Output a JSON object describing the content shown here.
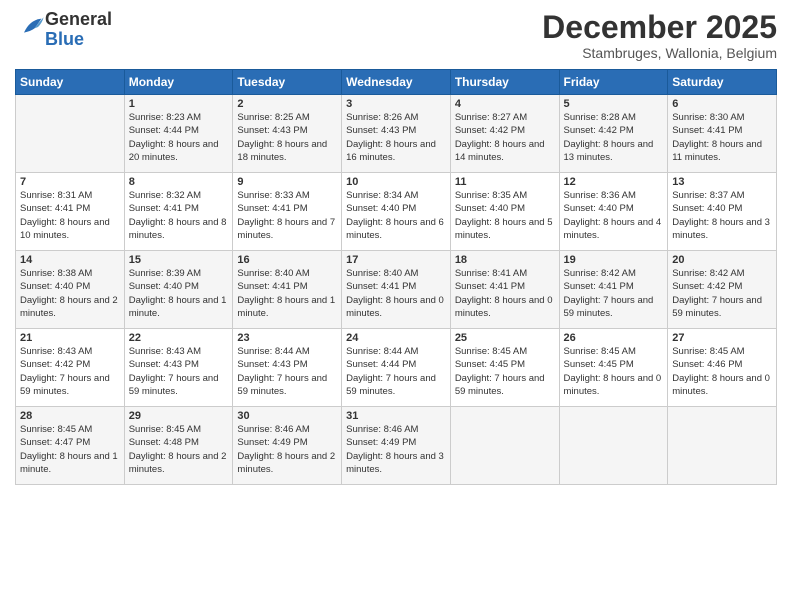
{
  "header": {
    "logo_general": "General",
    "logo_blue": "Blue",
    "month": "December 2025",
    "location": "Stambruges, Wallonia, Belgium"
  },
  "days_of_week": [
    "Sunday",
    "Monday",
    "Tuesday",
    "Wednesday",
    "Thursday",
    "Friday",
    "Saturday"
  ],
  "weeks": [
    [
      {
        "day": "",
        "sunrise": "",
        "sunset": "",
        "daylight": ""
      },
      {
        "day": "1",
        "sunrise": "Sunrise: 8:23 AM",
        "sunset": "Sunset: 4:44 PM",
        "daylight": "Daylight: 8 hours and 20 minutes."
      },
      {
        "day": "2",
        "sunrise": "Sunrise: 8:25 AM",
        "sunset": "Sunset: 4:43 PM",
        "daylight": "Daylight: 8 hours and 18 minutes."
      },
      {
        "day": "3",
        "sunrise": "Sunrise: 8:26 AM",
        "sunset": "Sunset: 4:43 PM",
        "daylight": "Daylight: 8 hours and 16 minutes."
      },
      {
        "day": "4",
        "sunrise": "Sunrise: 8:27 AM",
        "sunset": "Sunset: 4:42 PM",
        "daylight": "Daylight: 8 hours and 14 minutes."
      },
      {
        "day": "5",
        "sunrise": "Sunrise: 8:28 AM",
        "sunset": "Sunset: 4:42 PM",
        "daylight": "Daylight: 8 hours and 13 minutes."
      },
      {
        "day": "6",
        "sunrise": "Sunrise: 8:30 AM",
        "sunset": "Sunset: 4:41 PM",
        "daylight": "Daylight: 8 hours and 11 minutes."
      }
    ],
    [
      {
        "day": "7",
        "sunrise": "Sunrise: 8:31 AM",
        "sunset": "Sunset: 4:41 PM",
        "daylight": "Daylight: 8 hours and 10 minutes."
      },
      {
        "day": "8",
        "sunrise": "Sunrise: 8:32 AM",
        "sunset": "Sunset: 4:41 PM",
        "daylight": "Daylight: 8 hours and 8 minutes."
      },
      {
        "day": "9",
        "sunrise": "Sunrise: 8:33 AM",
        "sunset": "Sunset: 4:41 PM",
        "daylight": "Daylight: 8 hours and 7 minutes."
      },
      {
        "day": "10",
        "sunrise": "Sunrise: 8:34 AM",
        "sunset": "Sunset: 4:40 PM",
        "daylight": "Daylight: 8 hours and 6 minutes."
      },
      {
        "day": "11",
        "sunrise": "Sunrise: 8:35 AM",
        "sunset": "Sunset: 4:40 PM",
        "daylight": "Daylight: 8 hours and 5 minutes."
      },
      {
        "day": "12",
        "sunrise": "Sunrise: 8:36 AM",
        "sunset": "Sunset: 4:40 PM",
        "daylight": "Daylight: 8 hours and 4 minutes."
      },
      {
        "day": "13",
        "sunrise": "Sunrise: 8:37 AM",
        "sunset": "Sunset: 4:40 PM",
        "daylight": "Daylight: 8 hours and 3 minutes."
      }
    ],
    [
      {
        "day": "14",
        "sunrise": "Sunrise: 8:38 AM",
        "sunset": "Sunset: 4:40 PM",
        "daylight": "Daylight: 8 hours and 2 minutes."
      },
      {
        "day": "15",
        "sunrise": "Sunrise: 8:39 AM",
        "sunset": "Sunset: 4:40 PM",
        "daylight": "Daylight: 8 hours and 1 minute."
      },
      {
        "day": "16",
        "sunrise": "Sunrise: 8:40 AM",
        "sunset": "Sunset: 4:41 PM",
        "daylight": "Daylight: 8 hours and 1 minute."
      },
      {
        "day": "17",
        "sunrise": "Sunrise: 8:40 AM",
        "sunset": "Sunset: 4:41 PM",
        "daylight": "Daylight: 8 hours and 0 minutes."
      },
      {
        "day": "18",
        "sunrise": "Sunrise: 8:41 AM",
        "sunset": "Sunset: 4:41 PM",
        "daylight": "Daylight: 8 hours and 0 minutes."
      },
      {
        "day": "19",
        "sunrise": "Sunrise: 8:42 AM",
        "sunset": "Sunset: 4:41 PM",
        "daylight": "Daylight: 7 hours and 59 minutes."
      },
      {
        "day": "20",
        "sunrise": "Sunrise: 8:42 AM",
        "sunset": "Sunset: 4:42 PM",
        "daylight": "Daylight: 7 hours and 59 minutes."
      }
    ],
    [
      {
        "day": "21",
        "sunrise": "Sunrise: 8:43 AM",
        "sunset": "Sunset: 4:42 PM",
        "daylight": "Daylight: 7 hours and 59 minutes."
      },
      {
        "day": "22",
        "sunrise": "Sunrise: 8:43 AM",
        "sunset": "Sunset: 4:43 PM",
        "daylight": "Daylight: 7 hours and 59 minutes."
      },
      {
        "day": "23",
        "sunrise": "Sunrise: 8:44 AM",
        "sunset": "Sunset: 4:43 PM",
        "daylight": "Daylight: 7 hours and 59 minutes."
      },
      {
        "day": "24",
        "sunrise": "Sunrise: 8:44 AM",
        "sunset": "Sunset: 4:44 PM",
        "daylight": "Daylight: 7 hours and 59 minutes."
      },
      {
        "day": "25",
        "sunrise": "Sunrise: 8:45 AM",
        "sunset": "Sunset: 4:45 PM",
        "daylight": "Daylight: 7 hours and 59 minutes."
      },
      {
        "day": "26",
        "sunrise": "Sunrise: 8:45 AM",
        "sunset": "Sunset: 4:45 PM",
        "daylight": "Daylight: 8 hours and 0 minutes."
      },
      {
        "day": "27",
        "sunrise": "Sunrise: 8:45 AM",
        "sunset": "Sunset: 4:46 PM",
        "daylight": "Daylight: 8 hours and 0 minutes."
      }
    ],
    [
      {
        "day": "28",
        "sunrise": "Sunrise: 8:45 AM",
        "sunset": "Sunset: 4:47 PM",
        "daylight": "Daylight: 8 hours and 1 minute."
      },
      {
        "day": "29",
        "sunrise": "Sunrise: 8:45 AM",
        "sunset": "Sunset: 4:48 PM",
        "daylight": "Daylight: 8 hours and 2 minutes."
      },
      {
        "day": "30",
        "sunrise": "Sunrise: 8:46 AM",
        "sunset": "Sunset: 4:49 PM",
        "daylight": "Daylight: 8 hours and 2 minutes."
      },
      {
        "day": "31",
        "sunrise": "Sunrise: 8:46 AM",
        "sunset": "Sunset: 4:49 PM",
        "daylight": "Daylight: 8 hours and 3 minutes."
      },
      {
        "day": "",
        "sunrise": "",
        "sunset": "",
        "daylight": ""
      },
      {
        "day": "",
        "sunrise": "",
        "sunset": "",
        "daylight": ""
      },
      {
        "day": "",
        "sunrise": "",
        "sunset": "",
        "daylight": ""
      }
    ]
  ]
}
